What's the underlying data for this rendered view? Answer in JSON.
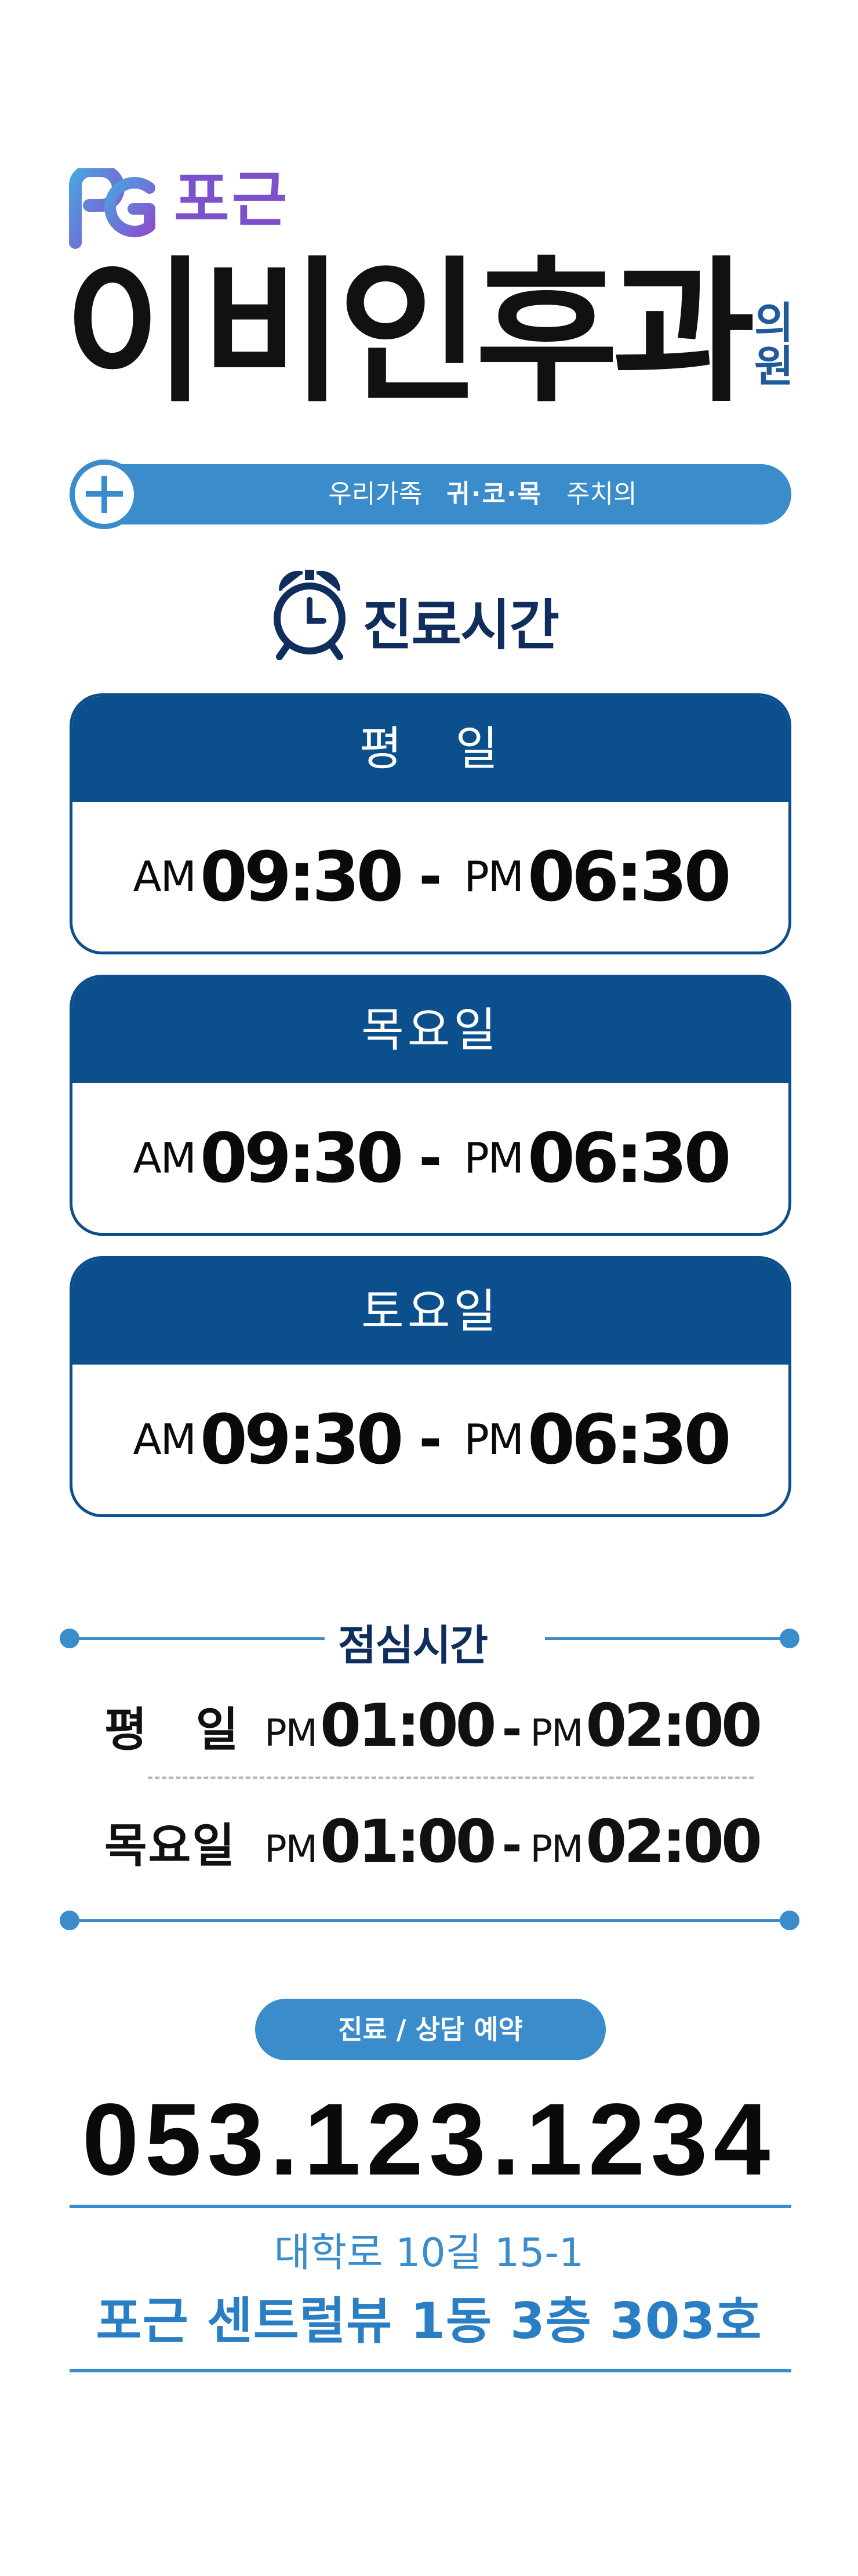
{
  "brand": {
    "logo_icon": "pg-logo-icon",
    "name": "포근",
    "title": "이비인후과",
    "suffix": "의원",
    "colors": {
      "logo_purple": "#7b52c9",
      "navy": "#0c4f8d",
      "accent_blue": "#3a8ccb"
    }
  },
  "tagline": {
    "icon": "plus-icon",
    "prefix": "우리가족",
    "highlight": "귀·코·목",
    "suffix": "주치의"
  },
  "hours": {
    "icon": "alarm-clock-icon",
    "heading": "진료시간",
    "cards": [
      {
        "day": "평　일",
        "start_ampm": "AM",
        "start_time": "09:30",
        "dash": "-",
        "end_ampm": "PM",
        "end_time": "06:30"
      },
      {
        "day": "목요일",
        "start_ampm": "AM",
        "start_time": "09:30",
        "dash": "-",
        "end_ampm": "PM",
        "end_time": "06:30"
      },
      {
        "day": "토요일",
        "start_ampm": "AM",
        "start_time": "09:30",
        "dash": "-",
        "end_ampm": "PM",
        "end_time": "06:30"
      }
    ]
  },
  "lunch": {
    "heading": "점심시간",
    "rows": [
      {
        "day": "평　일",
        "start_ampm": "PM",
        "start_time": "01:00",
        "dash": "-",
        "end_ampm": "PM",
        "end_time": "02:00"
      },
      {
        "day": "목요일",
        "start_ampm": "PM",
        "start_time": "01:00",
        "dash": "-",
        "end_ampm": "PM",
        "end_time": "02:00"
      }
    ]
  },
  "contact": {
    "reserve_label": "진료 / 상담 예약",
    "phone": "053.123.1234",
    "address_line1": "대학로 10길 15-1",
    "address_line2": "포근 센트럴뷰 1동 3층 303호"
  }
}
